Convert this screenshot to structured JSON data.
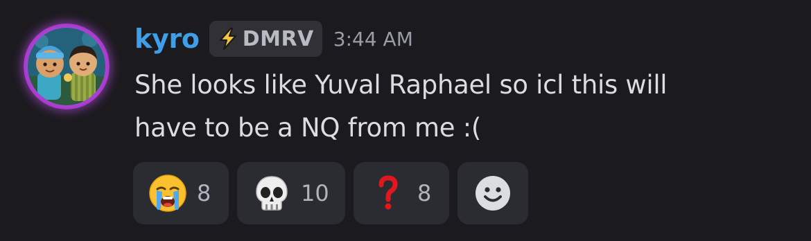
{
  "message": {
    "author": "kyro",
    "tag": {
      "icon": "lightning-bolt-icon",
      "label": "DMRV"
    },
    "timestamp": "3:44 AM",
    "lines": [
      "She looks like Yuval Raphael so icl this will",
      "have to be a NQ from me :("
    ]
  },
  "reactions": [
    {
      "emoji": "loudly-crying-face-icon",
      "count": "8"
    },
    {
      "emoji": "skull-icon",
      "count": "10"
    },
    {
      "emoji": "red-question-mark-icon",
      "count": "8"
    }
  ],
  "add_reaction": {
    "icon": "smiley-add-reaction-icon"
  },
  "colors": {
    "background": "#1b1b1f",
    "username": "#3f9ee8",
    "message_text": "#dcdde1",
    "tag_background": "#303036",
    "reaction_background": "#2b2c31",
    "avatar_glow": "#c04ce0"
  }
}
